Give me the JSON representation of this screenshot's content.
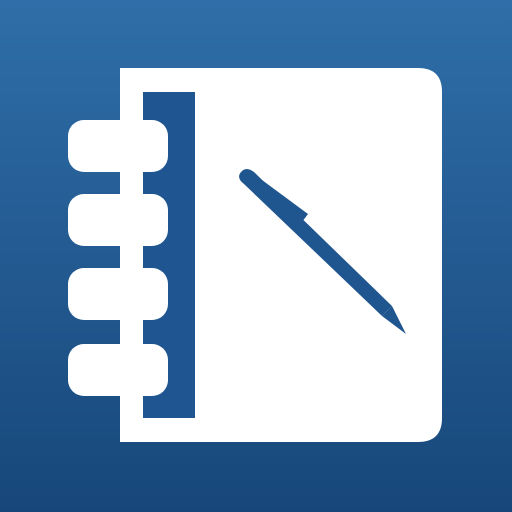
{
  "icon": {
    "depicts": "notebook-with-pen-icon",
    "colors": {
      "background_top": "#2f6ea8",
      "background_bottom": "#17477a",
      "notebook": "#ffffff",
      "ring": "#ffffff",
      "pen": "#20568f",
      "spine_stripe": "#1f5590"
    }
  }
}
